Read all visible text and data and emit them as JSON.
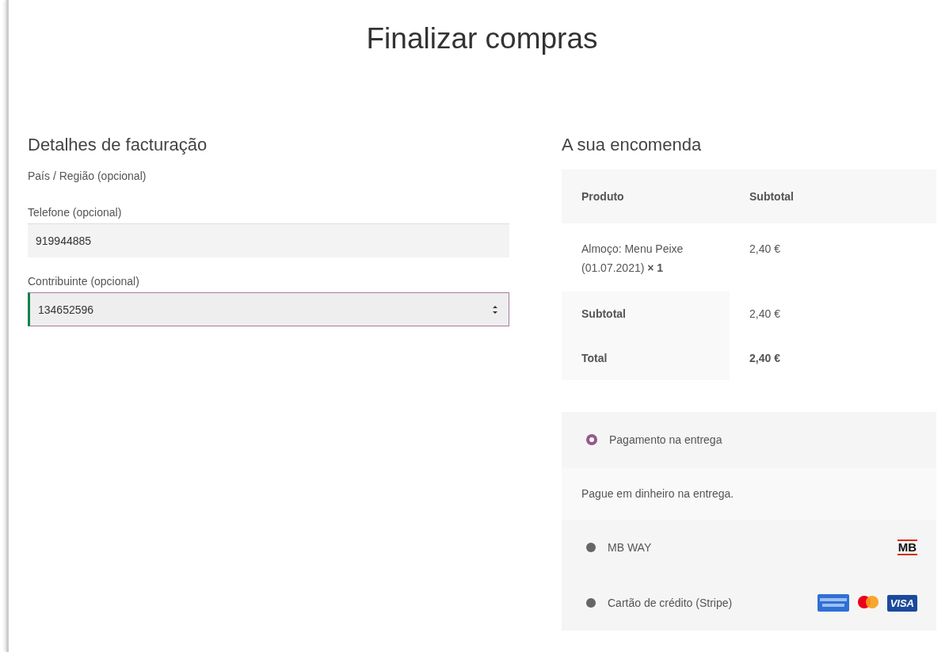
{
  "page_title": "Finalizar compras",
  "billing": {
    "heading": "Detalhes de facturação",
    "country_label": "País / Região (opcional)",
    "fields": [
      {
        "label": "Telefone (opcional)",
        "value": "919944885",
        "kind": "text",
        "focused": false
      },
      {
        "label": "Contribuinte (opcional)",
        "value": "134652596",
        "kind": "number",
        "focused": true
      }
    ]
  },
  "order": {
    "heading": "A sua encomenda",
    "columns": [
      "Produto",
      "Subtotal"
    ],
    "items": [
      {
        "name": "Almoço: Menu Peixe (01.07.2021)",
        "quantity": "× 1",
        "subtotal": "2,40 €"
      }
    ],
    "totals": [
      {
        "label": "Subtotal",
        "value": "2,40 €",
        "kind": "subtotal"
      },
      {
        "label": "Total",
        "value": "2,40 €",
        "kind": "total"
      }
    ]
  },
  "payment_methods": [
    {
      "label": "Pagamento na entrega",
      "selected": true,
      "description": "Pague em dinheiro na entrega."
    },
    {
      "label": "MB WAY",
      "selected": false,
      "logos": [
        {
          "kind": "mb",
          "label": "MB"
        }
      ]
    },
    {
      "label": "Cartão de crédito (Stripe)",
      "selected": false,
      "logos": [
        {
          "kind": "amex"
        },
        {
          "kind": "mastercard"
        },
        {
          "kind": "visa",
          "label": "VISA"
        }
      ]
    }
  ]
}
